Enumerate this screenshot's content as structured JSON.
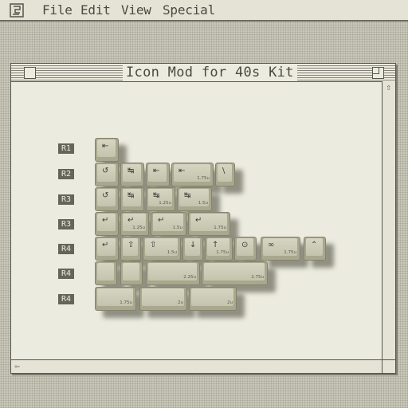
{
  "menubar": {
    "apple_icon": "⌘-glyph",
    "items": [
      "File",
      "Edit",
      "View",
      "Special"
    ]
  },
  "window": {
    "title": "Icon Mod for 40s Kit",
    "scroll_up_icon": "⇧",
    "scroll_left_icon": "⇦"
  },
  "rows": [
    "R1",
    "R2",
    "R3",
    "R3",
    "R4",
    "R4",
    "R4"
  ],
  "keys": {
    "k01": {
      "legend": "⇤",
      "size": ""
    },
    "k02": {
      "legend": "↺",
      "size": ""
    },
    "k03": {
      "legend": "↹",
      "size": ""
    },
    "k04": {
      "legend": "⇤",
      "size": ""
    },
    "k05": {
      "legend": "⇤",
      "size": "1.75u"
    },
    "k06": {
      "legend": "\\",
      "size": ""
    },
    "k07": {
      "legend": "↺",
      "size": ""
    },
    "k08": {
      "legend": "↹",
      "size": ""
    },
    "k09": {
      "legend": "↹",
      "size": "1.25u"
    },
    "k10": {
      "legend": "↹",
      "size": "1.5u"
    },
    "k11": {
      "legend": "↵",
      "size": ""
    },
    "k12": {
      "legend": "↵",
      "size": "1.25u"
    },
    "k13": {
      "legend": "↵",
      "size": "1.5u"
    },
    "k14": {
      "legend": "↵",
      "size": "1.75u"
    },
    "k15": {
      "legend": "↵",
      "size": ""
    },
    "k16": {
      "legend": "⇧",
      "size": ""
    },
    "k17": {
      "legend": "⇧",
      "size": "1.5u"
    },
    "k18": {
      "legend": "↓",
      "size": ""
    },
    "k19": {
      "legend": "↑",
      "size": "1.75u"
    },
    "k20": {
      "legend": "⊙",
      "size": ""
    },
    "k21": {
      "legend": "∞",
      "size": "1.75u"
    },
    "k22": {
      "legend": "⌃",
      "size": ""
    },
    "k23": {
      "legend": "",
      "size": ""
    },
    "k24": {
      "legend": "",
      "size": ""
    },
    "k25": {
      "legend": "",
      "size": "2.25u"
    },
    "k26": {
      "legend": "",
      "size": "2.75u"
    },
    "k27": {
      "legend": "",
      "size": "1.75u"
    },
    "k28": {
      "legend": "",
      "size": "2u"
    },
    "k29": {
      "legend": "",
      "size": "2u"
    }
  },
  "colors": {
    "desktop": "#c7c6b8",
    "window": "#ecebdf",
    "keycap": "#cbcab4",
    "label": "#66655a"
  }
}
